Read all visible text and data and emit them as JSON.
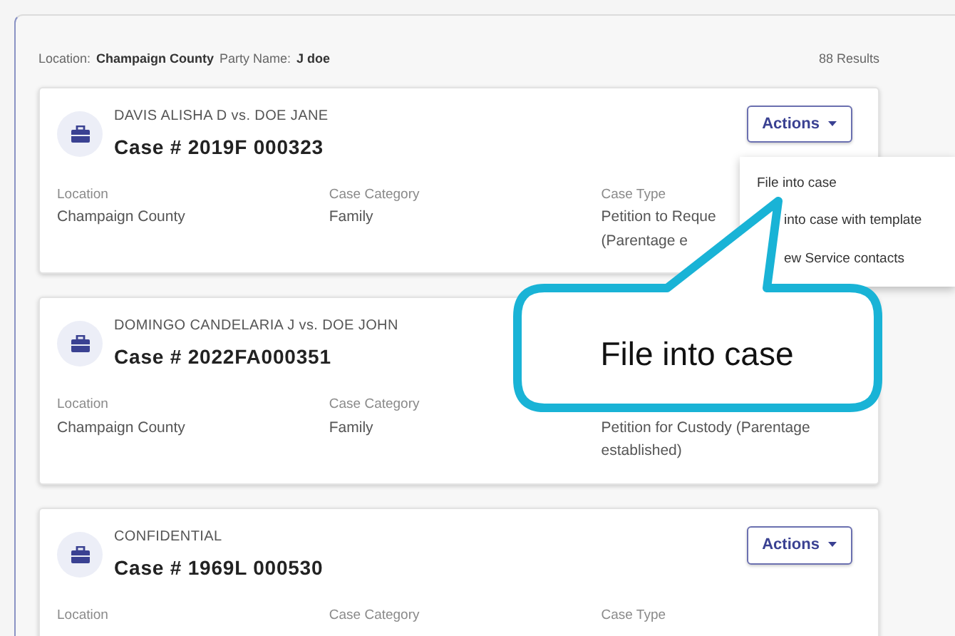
{
  "filter": {
    "items": [
      {
        "label": "Location:",
        "value": "Champaign County"
      },
      {
        "label": "Party Name:",
        "value": "J doe"
      }
    ],
    "results": "88 Results"
  },
  "cases": [
    {
      "parties": "DAVIS ALISHA D vs. DOE JANE",
      "number": "Case # 2019F 000323",
      "actions": "Actions",
      "fields": [
        {
          "label": "Location",
          "lines": [
            "Champaign County"
          ]
        },
        {
          "label": "Case Category",
          "lines": [
            "Family"
          ]
        },
        {
          "label": "Case Type",
          "lines": [
            "Petition to Reque",
            "(Parentage e"
          ]
        }
      ]
    },
    {
      "parties": "DOMINGO CANDELARIA J vs. DOE JOHN",
      "number": "Case # 2022FA000351",
      "fields": [
        {
          "label": "Location",
          "lines": [
            "Champaign County"
          ]
        },
        {
          "label": "Case Category",
          "lines": [
            "Family"
          ]
        },
        {
          "lines": [
            "Petition for Custody (Parentage",
            "established)"
          ]
        }
      ]
    },
    {
      "parties": "CONFIDENTIAL",
      "number": "Case # 1969L 000530",
      "actions": "Actions",
      "fields": [
        {
          "label": "Location"
        },
        {
          "label": "Case Category"
        },
        {
          "label": "Case Type"
        }
      ]
    }
  ],
  "menu": [
    {
      "label": "File into case",
      "covered": false
    },
    {
      "label": "into case with template",
      "covered": true
    },
    {
      "label": "ew Service contacts",
      "covered": true
    }
  ],
  "callout": "File into case"
}
